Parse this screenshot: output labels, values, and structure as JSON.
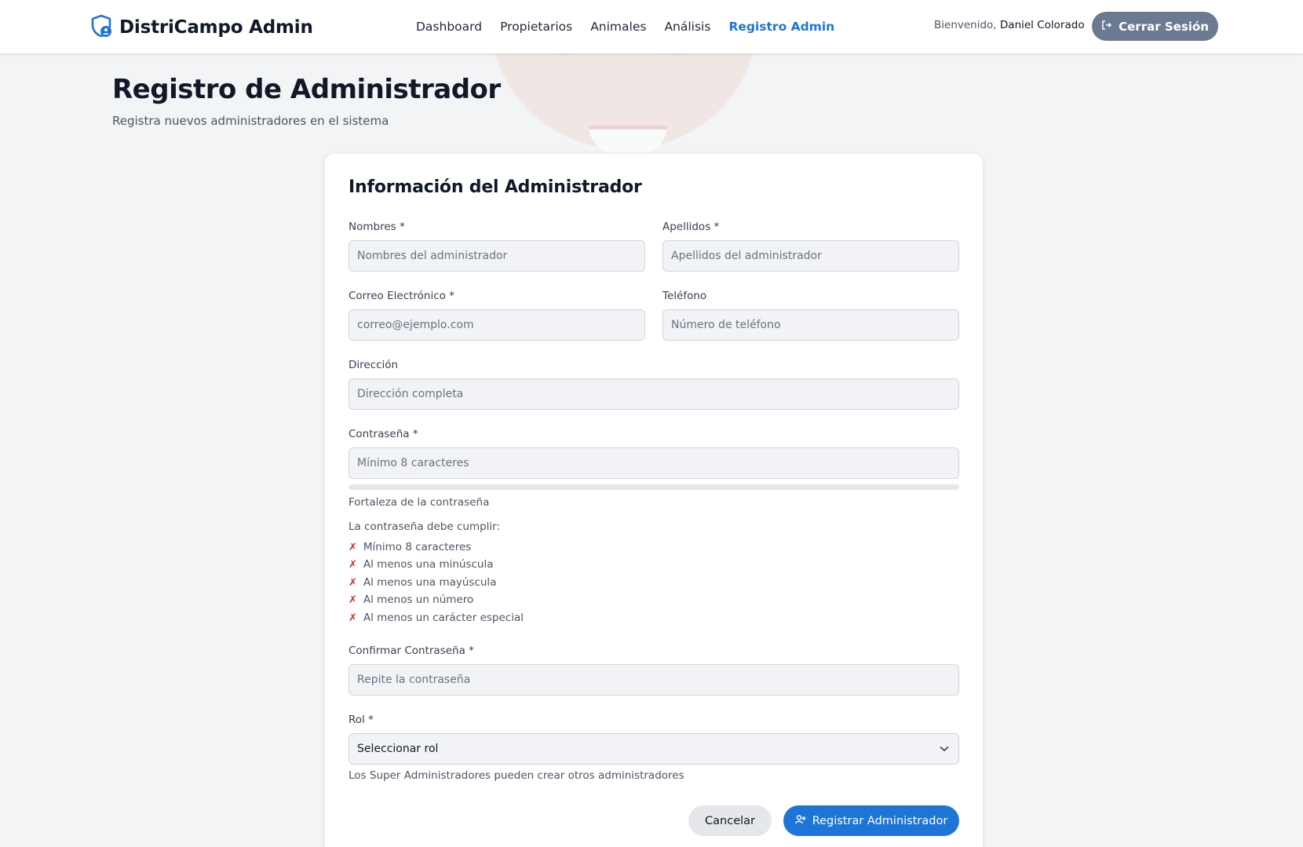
{
  "brand": {
    "name": "DistriCampo Admin",
    "icon": "shield-user-icon",
    "color": "#1d75d8"
  },
  "nav": {
    "items": [
      {
        "label": "Dashboard",
        "active": false
      },
      {
        "label": "Propietarios",
        "active": false
      },
      {
        "label": "Animales",
        "active": false
      },
      {
        "label": "Análisis",
        "active": false
      },
      {
        "label": "Registro Admin",
        "active": true
      }
    ]
  },
  "user": {
    "welcome": "Bienvenido,",
    "name": "Daniel Colorado"
  },
  "logout": {
    "label": "Cerrar Sesión",
    "icon": "logout-icon"
  },
  "page": {
    "title": "Registro de Administrador",
    "subtitle": "Registra nuevos administradores en el sistema"
  },
  "form": {
    "title": "Información del Administrador",
    "nombres": {
      "label": "Nombres *",
      "placeholder": "Nombres del administrador",
      "value": ""
    },
    "apellidos": {
      "label": "Apellidos *",
      "placeholder": "Apellidos del administrador",
      "value": ""
    },
    "correo": {
      "label": "Correo Electrónico *",
      "placeholder": "correo@ejemplo.com",
      "value": ""
    },
    "telefono": {
      "label": "Teléfono",
      "placeholder": "Número de teléfono",
      "value": ""
    },
    "direccion": {
      "label": "Dirección",
      "placeholder": "Dirección completa",
      "value": ""
    },
    "password": {
      "label": "Contraseña *",
      "placeholder": "Mínimo 8 caracteres",
      "value": "",
      "strength": 0
    },
    "strength_label": "Fortaleza de la contraseña",
    "requirements_title": "La contraseña debe cumplir:",
    "requirements": [
      {
        "mark": "✗",
        "text": "Mínimo 8 caracteres"
      },
      {
        "mark": "✗",
        "text": "Al menos una minúscula"
      },
      {
        "mark": "✗",
        "text": "Al menos una mayúscula"
      },
      {
        "mark": "✗",
        "text": "Al menos un número"
      },
      {
        "mark": "✗",
        "text": "Al menos un carácter especial"
      }
    ],
    "confirm": {
      "label": "Confirmar Contraseña *",
      "placeholder": "Repite la contraseña",
      "value": ""
    },
    "rol": {
      "label": "Rol *",
      "selected": "Seleccionar rol",
      "hint": "Los Super Administradores pueden crear otros administradores"
    },
    "cancel_label": "Cancelar",
    "submit_label": "Registrar Administrador",
    "submit_icon": "user-plus-icon"
  },
  "colors": {
    "accent": "#1d75d8",
    "logout_bg": "#6b7a90",
    "error": "#dc2626"
  }
}
